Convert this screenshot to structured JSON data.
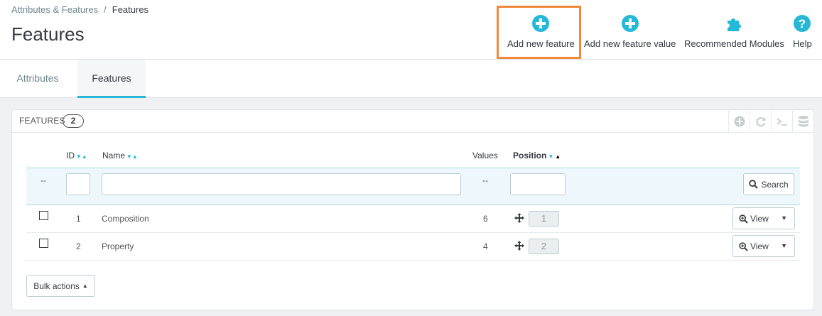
{
  "breadcrumb": {
    "parent": "Attributes & Features",
    "separator": "/",
    "current": "Features"
  },
  "page": {
    "title": "Features"
  },
  "toolbar": {
    "add_feature": "Add new feature",
    "add_feature_value": "Add new feature value",
    "recommended_modules": "Recommended Modules",
    "help": "Help"
  },
  "tabs": [
    {
      "label": "Attributes",
      "active": false
    },
    {
      "label": "Features",
      "active": true
    }
  ],
  "panel": {
    "title": "FEATURES",
    "count": "2"
  },
  "table": {
    "headers": {
      "id": "ID",
      "name": "Name",
      "values": "Values",
      "position": "Position"
    },
    "filter": {
      "id_placeholder": "--",
      "values_placeholder": "--",
      "search_label": "Search"
    },
    "rows": [
      {
        "id": "1",
        "name": "Composition",
        "values": "6",
        "position": "1",
        "action": "View"
      },
      {
        "id": "2",
        "name": "Property",
        "values": "4",
        "position": "2",
        "action": "View"
      }
    ],
    "bulk_actions": "Bulk actions"
  },
  "colors": {
    "accent": "#25b9d7",
    "highlight": "#f08a3b"
  }
}
